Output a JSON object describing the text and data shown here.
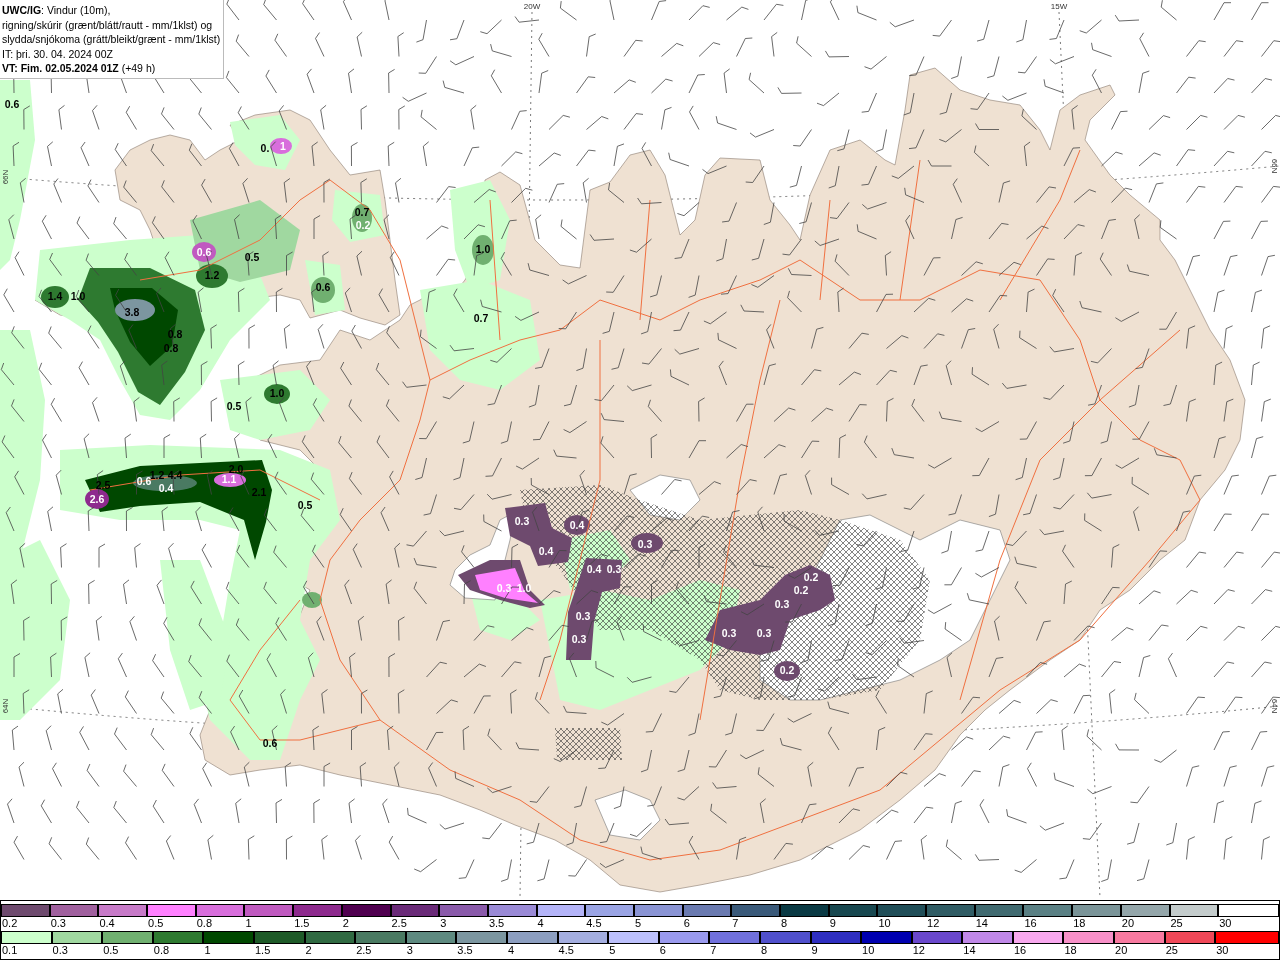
{
  "header": {
    "title_lines": [
      "**UWC/IG**: Vindur (10m),",
      "rigning/skúrir (grænt/blátt/rautt - mm/1klst) og",
      "slydda/snjókoma (grátt/bleikt/grænt - mm/1klst)"
    ],
    "issue_time": "IT: þri. 30. 04. 2024 00Z",
    "valid_time": "**VT: Fim. 02.05.2024 01Z** (+49 h)"
  },
  "map": {
    "axis_labels": [
      {
        "text": "20W",
        "kind": "longitude"
      },
      {
        "text": "15W",
        "kind": "longitude"
      },
      {
        "text": "66N",
        "kind": "latitude"
      },
      {
        "text": "66N",
        "kind": "latitude"
      },
      {
        "text": "64N",
        "kind": "latitude"
      },
      {
        "text": "64N",
        "kind": "latitude"
      }
    ],
    "value_labels": [
      {
        "text": "0.6",
        "kind": "rain"
      },
      {
        "text": "0.",
        "kind": "rain"
      },
      {
        "text": "1",
        "kind": "snow"
      },
      {
        "text": "0.7",
        "kind": "rain"
      },
      {
        "text": "0.2",
        "kind": "snow"
      },
      {
        "text": "0.6",
        "kind": "snow"
      },
      {
        "text": "0.5",
        "kind": "rain"
      },
      {
        "text": "1.2",
        "kind": "rain"
      },
      {
        "text": "0.6",
        "kind": "rain"
      },
      {
        "text": "1.4",
        "kind": "rain"
      },
      {
        "text": "1.0",
        "kind": "rain"
      },
      {
        "text": "3.8",
        "kind": "rain"
      },
      {
        "text": "0.8",
        "kind": "rain"
      },
      {
        "text": "0.8",
        "kind": "rain"
      },
      {
        "text": "1.0",
        "kind": "rain"
      },
      {
        "text": "0.5",
        "kind": "rain"
      },
      {
        "text": "2.0",
        "kind": "rain"
      },
      {
        "text": "1.2",
        "kind": "rain"
      },
      {
        "text": "4.4",
        "kind": "rain"
      },
      {
        "text": "0.6",
        "kind": "snow"
      },
      {
        "text": "0.4",
        "kind": "snow"
      },
      {
        "text": "1.1",
        "kind": "snow"
      },
      {
        "text": "2.5",
        "kind": "rain"
      },
      {
        "text": "2.6",
        "kind": "snow"
      },
      {
        "text": "2.1",
        "kind": "rain"
      },
      {
        "text": "0.5",
        "kind": "rain"
      },
      {
        "text": "1.0",
        "kind": "rain"
      },
      {
        "text": "0.7",
        "kind": "rain"
      },
      {
        "text": "0.6",
        "kind": "rain"
      },
      {
        "text": "0.3",
        "kind": "snow"
      },
      {
        "text": "0.4",
        "kind": "snow"
      },
      {
        "text": "0.4",
        "kind": "snow"
      },
      {
        "text": "0.3",
        "kind": "snow"
      },
      {
        "text": "0.4",
        "kind": "snow"
      },
      {
        "text": "0.3",
        "kind": "snow"
      },
      {
        "text": "0.3",
        "kind": "snow"
      },
      {
        "text": "1.0",
        "kind": "snow"
      },
      {
        "text": "0.3",
        "kind": "snow"
      },
      {
        "text": "0.3",
        "kind": "snow"
      },
      {
        "text": "0.2",
        "kind": "snow"
      },
      {
        "text": "0.2",
        "kind": "snow"
      },
      {
        "text": "0.3",
        "kind": "snow"
      },
      {
        "text": "0.3",
        "kind": "snow"
      },
      {
        "text": "0.3",
        "kind": "snow"
      },
      {
        "text": "0.2",
        "kind": "snow"
      }
    ]
  },
  "legend": {
    "snow": [
      {
        "label": "0.2",
        "color": "#6e4a6e"
      },
      {
        "label": "0.3",
        "color": "#a0609e"
      },
      {
        "label": "0.4",
        "color": "#c77ac8"
      },
      {
        "label": "0.5",
        "color": "#ff80ff"
      },
      {
        "label": "0.8",
        "color": "#d86edc"
      },
      {
        "label": "1",
        "color": "#c05ac0"
      },
      {
        "label": "1.5",
        "color": "#8e2a8e"
      },
      {
        "label": "2",
        "color": "#500050"
      },
      {
        "label": "2.5",
        "color": "#6a2a78"
      },
      {
        "label": "3",
        "color": "#8a5aaa"
      },
      {
        "label": "3.5",
        "color": "#9a8ad6"
      },
      {
        "label": "4",
        "color": "#b4b4f8"
      },
      {
        "label": "4.5",
        "color": "#9aa4e4"
      },
      {
        "label": "5",
        "color": "#8a94d4"
      },
      {
        "label": "6",
        "color": "#6a7ab0"
      },
      {
        "label": "7",
        "color": "#3a5a7a"
      },
      {
        "label": "8",
        "color": "#0a3a44"
      },
      {
        "label": "9",
        "color": "#184850"
      },
      {
        "label": "10",
        "color": "#204e58"
      },
      {
        "label": "12",
        "color": "#305c64"
      },
      {
        "label": "14",
        "color": "#406a70"
      },
      {
        "label": "16",
        "color": "#5a8084"
      },
      {
        "label": "18",
        "color": "#7a9498"
      },
      {
        "label": "20",
        "color": "#94a6aa"
      },
      {
        "label": "25",
        "color": "#c4cccc"
      },
      {
        "label": "30",
        "color": "#ffffff"
      }
    ],
    "rain": [
      {
        "label": "0.1",
        "color": "#ccffcc"
      },
      {
        "label": "0.3",
        "color": "#a0d8a0"
      },
      {
        "label": "0.5",
        "color": "#70b070"
      },
      {
        "label": "0.8",
        "color": "#2e7a30"
      },
      {
        "label": "1",
        "color": "#004800"
      },
      {
        "label": "1.5",
        "color": "#1e5a28"
      },
      {
        "label": "2",
        "color": "#306a42"
      },
      {
        "label": "2.5",
        "color": "#4a7a62"
      },
      {
        "label": "3",
        "color": "#5e8a80"
      },
      {
        "label": "3.5",
        "color": "#7c96a0"
      },
      {
        "label": "4",
        "color": "#8c9ec0"
      },
      {
        "label": "4.5",
        "color": "#a4aee0"
      },
      {
        "label": "5",
        "color": "#bcc0fc"
      },
      {
        "label": "6",
        "color": "#9a9aee"
      },
      {
        "label": "7",
        "color": "#7070dc"
      },
      {
        "label": "8",
        "color": "#5050cc"
      },
      {
        "label": "9",
        "color": "#2e2ec0"
      },
      {
        "label": "10",
        "color": "#0000b0"
      },
      {
        "label": "12",
        "color": "#6a48cc"
      },
      {
        "label": "14",
        "color": "#c088e8"
      },
      {
        "label": "16",
        "color": "#f8a8ee"
      },
      {
        "label": "18",
        "color": "#f890c8"
      },
      {
        "label": "20",
        "color": "#f87aa0"
      },
      {
        "label": "25",
        "color": "#f04858"
      },
      {
        "label": "30",
        "color": "#ff0000"
      }
    ]
  }
}
